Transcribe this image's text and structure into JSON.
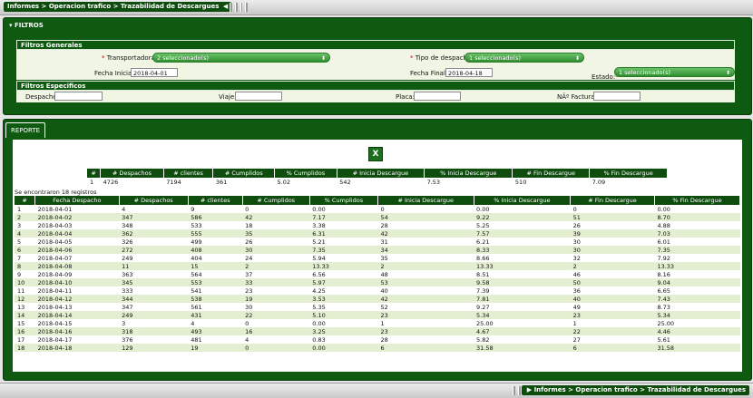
{
  "breadcrumb": {
    "label": "Informes > Operacion trafico > Trazabilidad de Descargues"
  },
  "filtros": {
    "title": "FILTROS",
    "generales_title": "Filtros Generales",
    "especificos_title": "Filtros Especificos",
    "transportadoras_label": "Transportadoras:",
    "transportadoras_value": "2 seleccionado(s)",
    "tipo_label": "Tipo de despacho:",
    "tipo_value": "1 seleccionado(s)",
    "fecha_inicial_label": "Fecha Inicial:",
    "fecha_inicial_value": "2018-04-01",
    "fecha_final_label": "Fecha Final:",
    "fecha_final_value": "2018-04-18",
    "estado_label": "Estado:",
    "estado_value": "1 seleccionado(s)",
    "despacho_label": "Despacho:",
    "viaje_label": "Viaje:",
    "placa_label": "Placa:",
    "factura_label": "NÂº Factura:"
  },
  "reporte": {
    "tab": "REPORTE",
    "excel_glyph": "X",
    "summary_headers": [
      "#",
      "# Despachos",
      "# clientes",
      "# Cumplidos",
      "% Cumplidos",
      "# Inicia Descargue",
      "% Inicia Descargue",
      "# Fin Descargue",
      "% Fin Descargue"
    ],
    "summary_row": [
      "1",
      "4726",
      "7194",
      "361",
      "5.02",
      "542",
      "7.53",
      "510",
      "7.09"
    ],
    "registros": "Se encontraron 18 registros",
    "headers": [
      "#",
      "Fecha Despacho",
      "# Despachos",
      "# clientes",
      "# Cumplidos",
      "% Cumplidos",
      "# Inicia Descargue",
      "% Inicia Descargue",
      "# Fin Descargue",
      "% Fin Descargue"
    ],
    "rows": [
      [
        "1",
        "2018-04-01",
        "4",
        "9",
        "0",
        "0.00",
        "0",
        "0.00",
        "0",
        "0.00"
      ],
      [
        "2",
        "2018-04-02",
        "347",
        "586",
        "42",
        "7.17",
        "54",
        "9.22",
        "51",
        "8.70"
      ],
      [
        "3",
        "2018-04-03",
        "348",
        "533",
        "18",
        "3.38",
        "28",
        "5.25",
        "26",
        "4.88"
      ],
      [
        "4",
        "2018-04-04",
        "362",
        "555",
        "35",
        "6.31",
        "42",
        "7.57",
        "39",
        "7.03"
      ],
      [
        "5",
        "2018-04-05",
        "326",
        "499",
        "26",
        "5.21",
        "31",
        "6.21",
        "30",
        "6.01"
      ],
      [
        "6",
        "2018-04-06",
        "272",
        "408",
        "30",
        "7.35",
        "34",
        "8.33",
        "30",
        "7.35"
      ],
      [
        "7",
        "2018-04-07",
        "249",
        "404",
        "24",
        "5.94",
        "35",
        "8.66",
        "32",
        "7.92"
      ],
      [
        "8",
        "2018-04-08",
        "11",
        "15",
        "2",
        "13.33",
        "2",
        "13.33",
        "2",
        "13.33"
      ],
      [
        "9",
        "2018-04-09",
        "363",
        "564",
        "37",
        "6.56",
        "48",
        "8.51",
        "46",
        "8.16"
      ],
      [
        "10",
        "2018-04-10",
        "345",
        "553",
        "33",
        "5.97",
        "53",
        "9.58",
        "50",
        "9.04"
      ],
      [
        "11",
        "2018-04-11",
        "333",
        "541",
        "23",
        "4.25",
        "40",
        "7.39",
        "36",
        "6.65"
      ],
      [
        "12",
        "2018-04-12",
        "344",
        "538",
        "19",
        "3.53",
        "42",
        "7.81",
        "40",
        "7.43"
      ],
      [
        "13",
        "2018-04-13",
        "347",
        "561",
        "30",
        "5.35",
        "52",
        "9.27",
        "49",
        "8.73"
      ],
      [
        "14",
        "2018-04-14",
        "249",
        "431",
        "22",
        "5.10",
        "23",
        "5.34",
        "23",
        "5.34"
      ],
      [
        "15",
        "2018-04-15",
        "3",
        "4",
        "0",
        "0.00",
        "1",
        "25.00",
        "1",
        "25.00"
      ],
      [
        "16",
        "2018-04-16",
        "318",
        "493",
        "16",
        "3.25",
        "23",
        "4.67",
        "22",
        "4.46"
      ],
      [
        "17",
        "2018-04-17",
        "376",
        "481",
        "4",
        "0.83",
        "28",
        "5.82",
        "27",
        "5.61"
      ],
      [
        "18",
        "2018-04-18",
        "129",
        "19",
        "0",
        "0.00",
        "6",
        "31.58",
        "6",
        "31.58"
      ]
    ]
  }
}
